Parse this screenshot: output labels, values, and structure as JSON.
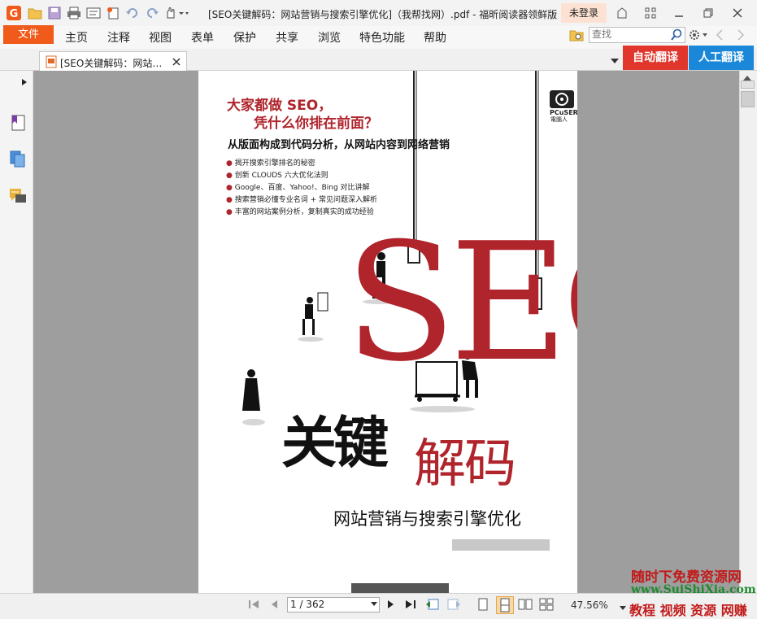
{
  "window": {
    "title": "[SEO关键解码：网站营销与搜索引擎优化]（我帮找网）.pdf - 福昕阅读器领鲜版",
    "login": "未登录"
  },
  "menu": {
    "file": "文件",
    "items": [
      "主页",
      "注释",
      "视图",
      "表单",
      "保护",
      "共享",
      "浏览",
      "特色功能",
      "帮助"
    ],
    "search_placeholder": "查找"
  },
  "tab": {
    "label": "[SEO关键解码：网站…",
    "auto_translate": "自动翻译",
    "human_translate": "人工翻译"
  },
  "cover": {
    "headline1": "大家都做 SEO，",
    "headline2": "凭什么你排在前面？",
    "subtitle": "从版面构成到代码分析，从网站内容到网络营销",
    "bullets": [
      "揭开搜索引擎排名的秘密",
      "创新 CLOUDS 六大优化法则",
      "Google、百度、Yahoo!、Bing 对比讲解",
      "搜索营销必懂专业名词 + 常见问题深入解析",
      "丰富的网站案例分析，复制真实的成功经验"
    ],
    "publisher_logo_text": "PCuSER",
    "publisher_logo_sub": "電腦人",
    "seo_letters": "SEO",
    "title_bold": "关键",
    "title_light": "解码",
    "book_subtitle": "网站营销与搜索引擎优化"
  },
  "status": {
    "page_indicator": "1 / 362",
    "zoom": "47.56%"
  },
  "watermark": {
    "line1": "随时下免费资源网",
    "line2": "www.SuiShiXia.com",
    "line3": "教程 视频 资源 网赚"
  },
  "colors": {
    "accent_orange": "#f05a1a",
    "translate_red": "#e0362c",
    "translate_blue": "#1a87d8",
    "cover_red": "#b0242c"
  }
}
